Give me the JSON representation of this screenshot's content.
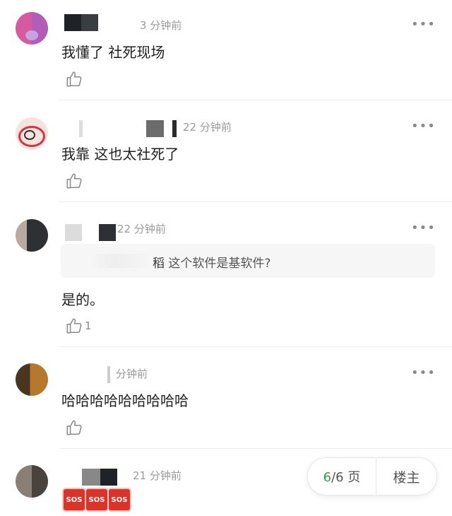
{
  "comments": [
    {
      "time": "3 分钟前",
      "text": "我懂了 社死现场",
      "likes": ""
    },
    {
      "time": "22 分钟前",
      "text": "我靠 这也太社死了",
      "likes": ""
    },
    {
      "time": "22 分钟前",
      "quote": "这个软件是基软件?",
      "quote_partial": "稻",
      "text": "是的。",
      "likes": "1"
    },
    {
      "time": "分钟前",
      "text": "哈哈哈哈哈哈哈哈哈",
      "likes": ""
    },
    {
      "time": "21 分钟前",
      "text": "",
      "likes": "",
      "emoji": [
        "SOS",
        "SOS",
        "SOS"
      ]
    }
  ],
  "pager": {
    "current": "6",
    "total_suffix": "/6 页",
    "host": "楼主"
  },
  "more_label": "•••",
  "colors": {
    "accent": "#2e9e45",
    "sos": "#d9332a"
  }
}
